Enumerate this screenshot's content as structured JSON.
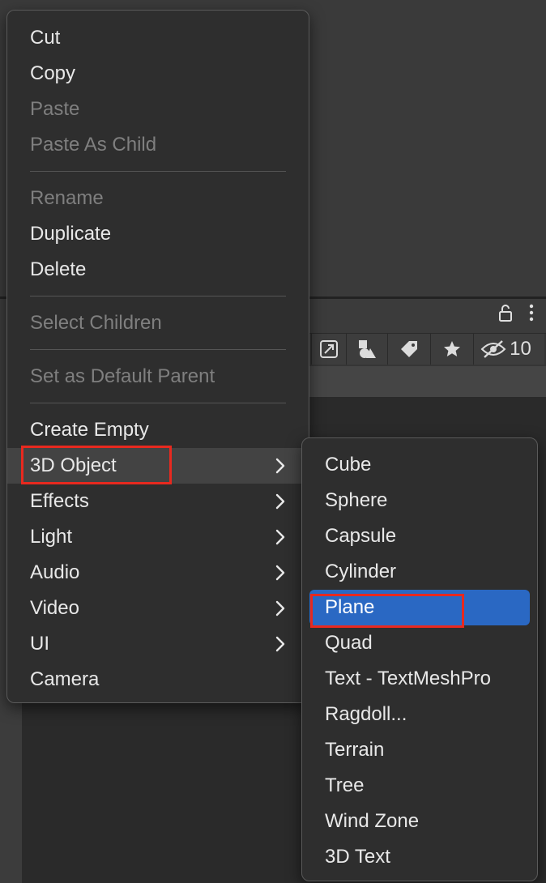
{
  "context_menu": {
    "items": [
      {
        "label": "Cut",
        "enabled": true
      },
      {
        "label": "Copy",
        "enabled": true
      },
      {
        "label": "Paste",
        "enabled": false
      },
      {
        "label": "Paste As Child",
        "enabled": false
      },
      {
        "label": "Rename",
        "enabled": false
      },
      {
        "label": "Duplicate",
        "enabled": true
      },
      {
        "label": "Delete",
        "enabled": true
      },
      {
        "label": "Select Children",
        "enabled": false
      },
      {
        "label": "Set as Default Parent",
        "enabled": false
      },
      {
        "label": "Create Empty",
        "enabled": true
      },
      {
        "label": "3D Object",
        "enabled": true,
        "has_submenu": true,
        "hovered": true
      },
      {
        "label": "Effects",
        "enabled": true,
        "has_submenu": true
      },
      {
        "label": "Light",
        "enabled": true,
        "has_submenu": true
      },
      {
        "label": "Audio",
        "enabled": true,
        "has_submenu": true
      },
      {
        "label": "Video",
        "enabled": true,
        "has_submenu": true
      },
      {
        "label": "UI",
        "enabled": true,
        "has_submenu": true
      },
      {
        "label": "Camera",
        "enabled": true
      }
    ]
  },
  "submenu_3d_object": {
    "items": [
      {
        "label": "Cube"
      },
      {
        "label": "Sphere"
      },
      {
        "label": "Capsule"
      },
      {
        "label": "Cylinder"
      },
      {
        "label": "Plane",
        "selected": true
      },
      {
        "label": "Quad"
      },
      {
        "label": "Text - TextMeshPro"
      },
      {
        "label": "Ragdoll..."
      },
      {
        "label": "Terrain"
      },
      {
        "label": "Tree"
      },
      {
        "label": "Wind Zone"
      },
      {
        "label": "3D Text"
      }
    ]
  },
  "background_toolbar": {
    "icons": [
      "lock-icon",
      "more-vertical-icon",
      "scene-picking-icon",
      "shapes-icon",
      "tag-icon",
      "star-icon",
      "hidden-eye-icon"
    ],
    "hidden_count": "10"
  },
  "colors": {
    "menu_bg": "#2e2e2e",
    "selected_bg": "#2a68c3",
    "annotation": "#e8291f",
    "disabled_text": "#7f7f7f"
  }
}
